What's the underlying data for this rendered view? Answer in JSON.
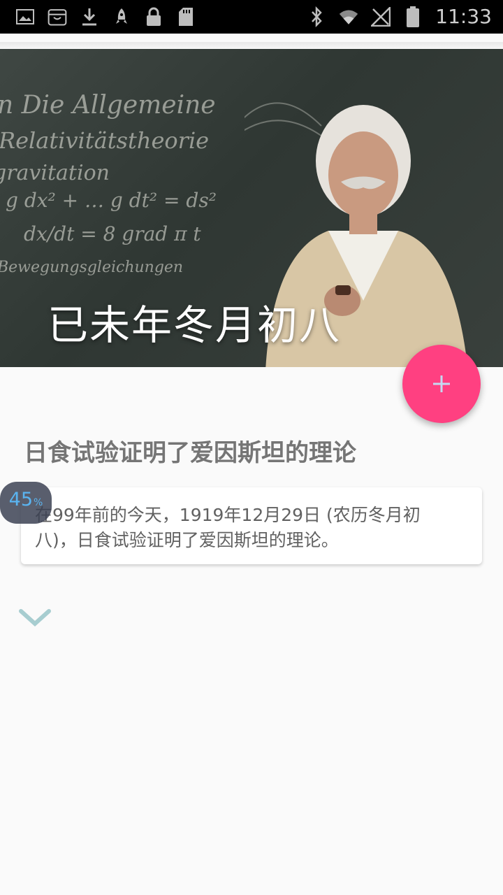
{
  "status_bar": {
    "time": "11:33",
    "left_icons": [
      "image-icon",
      "store-icon",
      "download-icon",
      "rocket-icon",
      "lock-icon",
      "sd-card-icon"
    ],
    "right_icons": [
      "bluetooth-icon",
      "wifi-icon",
      "signal-icon",
      "battery-icon"
    ]
  },
  "hero": {
    "title": "已未年冬月初八",
    "board_lines": [
      "n Die Allgemeine",
      "Relativitätstheorie",
      "gravitation",
      "g dx² + … g dt² = ds²",
      "dx/dt = 8 grad π t",
      "Bewegungsgleichungen"
    ]
  },
  "fab": {
    "label": "+"
  },
  "article": {
    "title": "日食试验证明了爱因斯坦的理论",
    "body": "在99年前的今天，1919年12月29日 (农历冬月初八)，日食试验证明了爱因斯坦的理论。"
  },
  "badge": {
    "value": "45",
    "unit": "%"
  },
  "colors": {
    "accent": "#ff4081",
    "badge_text": "#5ab4f0",
    "chevron": "#a7cdd0"
  }
}
